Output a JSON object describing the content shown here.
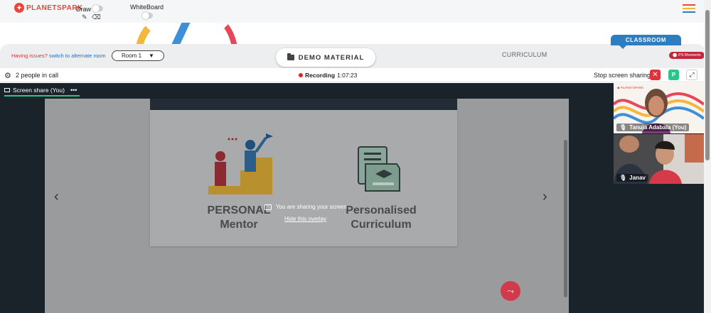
{
  "app": {
    "logo_text": "PLANETSPARK",
    "draw_label": "Draw",
    "whiteboard_label": "WhiteBoard"
  },
  "classbar": {
    "issues_text": "Having issues?",
    "alternate_link": "switch to alternate room",
    "room_selected": "Room 1",
    "demo_material": "DEMO MATERIAL",
    "curriculum": "CURRICULUM",
    "classroom_tab": "CLASSROOM",
    "moments": "PS Moments"
  },
  "call": {
    "people_count": "2 people in call",
    "recording_label": "Recording",
    "recording_time": "1:07:23",
    "stop_sharing": "Stop screen sharing",
    "avatar_initial": "P"
  },
  "share": {
    "tab_label": "Screen share (You)",
    "sharing_message": "You are sharing your screen",
    "hide_overlay": "Hide this overlay"
  },
  "slide": {
    "card1_title_line1": "PERSONAL",
    "card1_title_line2": "Mentor",
    "card2_title_line1": "Personalised",
    "card2_title_line2": "Curriculum"
  },
  "participants": [
    {
      "name": "Tanuja Adabala (You)"
    },
    {
      "name": "Janav"
    }
  ],
  "colors": {
    "brand_red": "#e8473c",
    "brand_blue": "#2d7ec0",
    "accent_green": "#2bc48a",
    "stop_red": "#e0323a"
  },
  "icons": [
    "pencil-icon",
    "eraser-icon",
    "hamburger-icon",
    "folder-icon",
    "gear-icon",
    "close-icon",
    "expand-icon",
    "screen-share-icon",
    "more-icon",
    "chevron-left-icon",
    "chevron-right-icon",
    "share-icon",
    "mic-icon"
  ]
}
